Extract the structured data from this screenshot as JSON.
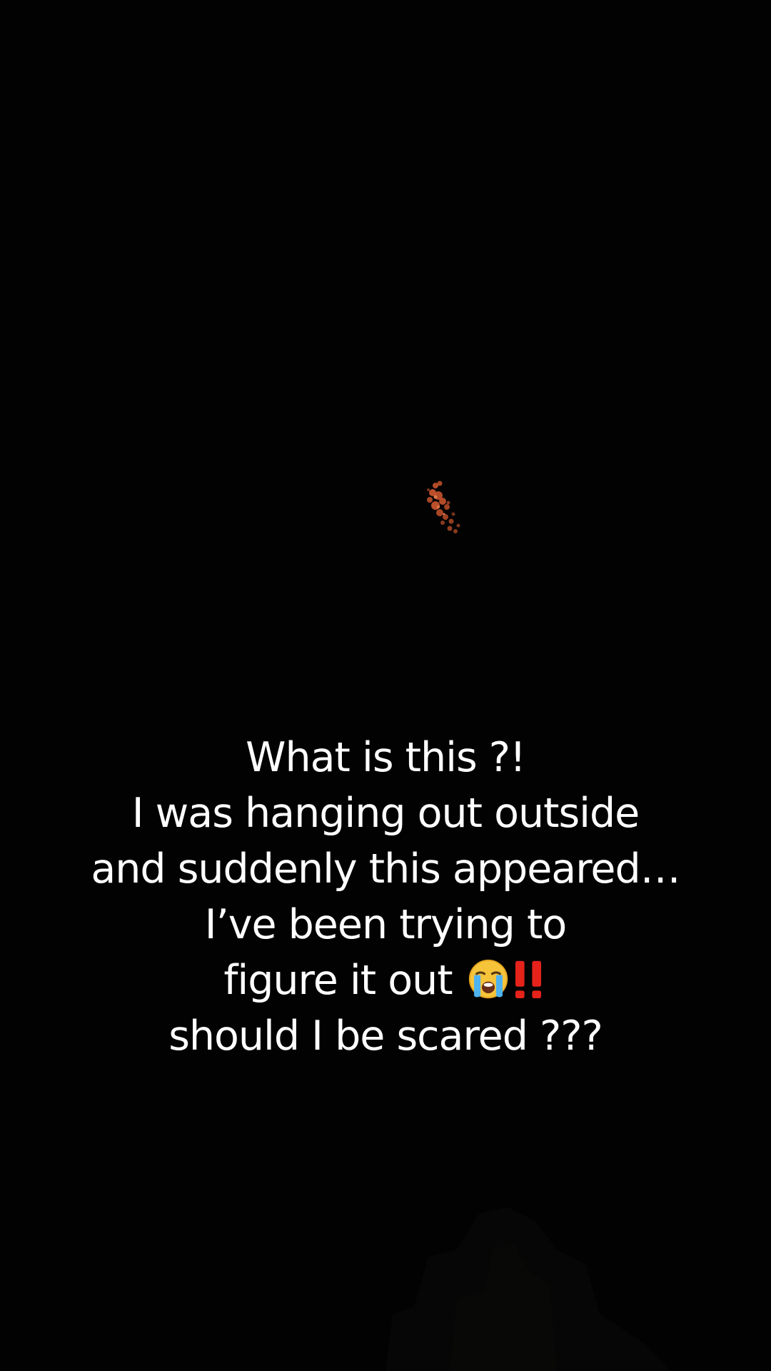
{
  "caption": {
    "lines": [
      "What is this ?!",
      "I was hanging out outside",
      "and suddenly this appeared…",
      "I’ve been trying to",
      "figure it out",
      "should I be scared ???"
    ],
    "emojis": [
      "loudly-crying-face-icon",
      "double-exclamation-icon"
    ],
    "text_color": "#ffffff"
  },
  "scene": {
    "background_color": "#020202",
    "light_color": "#c5532c"
  }
}
